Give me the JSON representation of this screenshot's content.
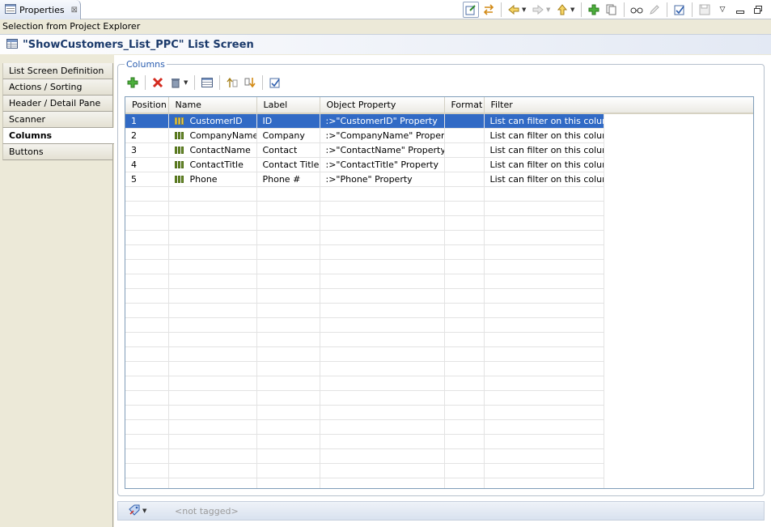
{
  "view_tab": {
    "label": "Properties",
    "close": "⊠"
  },
  "selection_label": "Selection from Project Explorer",
  "title": "\"ShowCustomers_List_PPC\" List Screen",
  "sidebar": {
    "items": [
      {
        "label": "List Screen Definition"
      },
      {
        "label": "Actions / Sorting"
      },
      {
        "label": "Header / Detail Pane"
      },
      {
        "label": "Scanner"
      },
      {
        "label": "Columns"
      },
      {
        "label": "Buttons"
      }
    ],
    "active": "Columns"
  },
  "group": {
    "label": "Columns"
  },
  "table": {
    "headers": [
      "Position",
      "Name",
      "Label",
      "Object Property",
      "Format",
      "Filter"
    ],
    "rows": [
      {
        "position": "1",
        "name": "CustomerID",
        "label": "ID",
        "object_property": ":>\"CustomerID\" Property",
        "format": "",
        "filter": "List can filter on this column",
        "selected": true
      },
      {
        "position": "2",
        "name": "CompanyName",
        "label": "Company",
        "object_property": ":>\"CompanyName\" Property",
        "format": "",
        "filter": "List can filter on this column"
      },
      {
        "position": "3",
        "name": "ContactName",
        "label": "Contact",
        "object_property": ":>\"ContactName\" Property",
        "format": "",
        "filter": "List can filter on this column"
      },
      {
        "position": "4",
        "name": "ContactTitle",
        "label": "Contact Title",
        "object_property": ":>\"ContactTitle\" Property",
        "format": "",
        "filter": "List can filter on this column"
      },
      {
        "position": "5",
        "name": "Phone",
        "label": "Phone #",
        "object_property": ":>\"Phone\" Property",
        "format": "",
        "filter": "List can filter on this column"
      }
    ]
  },
  "status": {
    "tag_text": "<not tagged>"
  },
  "colors": {
    "selection": "#316ac5",
    "group_label": "#2a5db0"
  }
}
